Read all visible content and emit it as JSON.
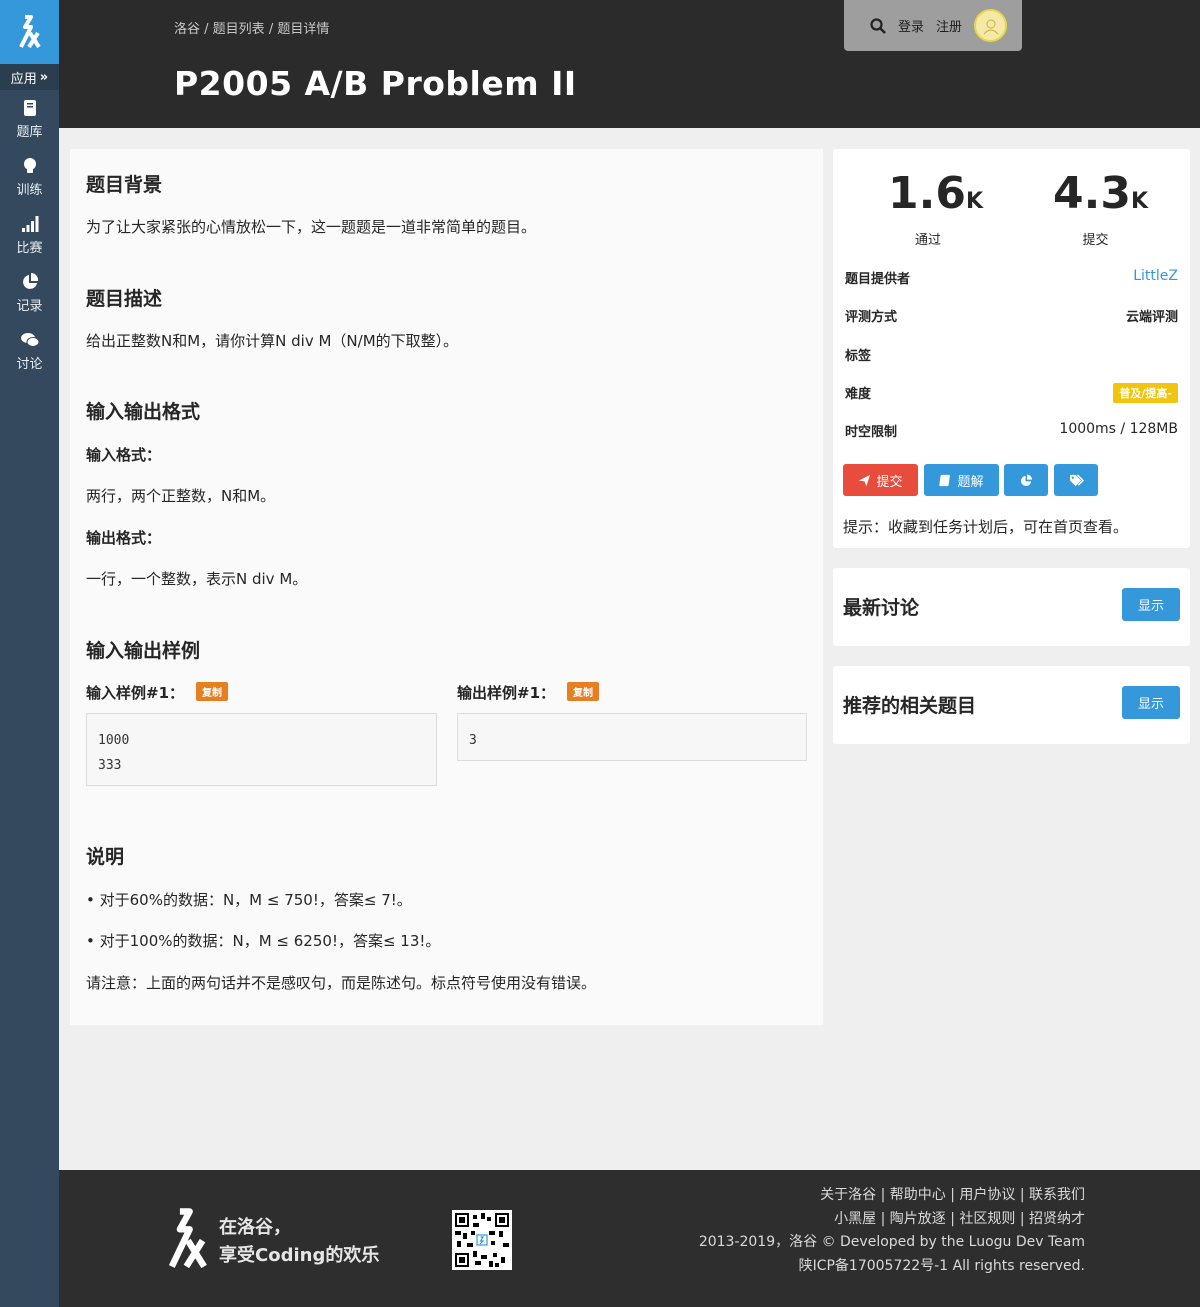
{
  "sidebar": {
    "app_label": "应用",
    "items": [
      {
        "label": "题库",
        "icon": "book-icon"
      },
      {
        "label": "训练",
        "icon": "lightbulb-icon"
      },
      {
        "label": "比赛",
        "icon": "signal-icon"
      },
      {
        "label": "记录",
        "icon": "pie-chart-icon"
      },
      {
        "label": "讨论",
        "icon": "comments-icon"
      }
    ]
  },
  "header": {
    "breadcrumb": [
      "洛谷",
      "题目列表",
      "题目详情"
    ],
    "separator": " / ",
    "title": "P2005 A/B Problem II",
    "login": "登录",
    "register": "注册"
  },
  "problem": {
    "background_title": "题目背景",
    "background_text": "为了让大家紧张的心情放松一下，这一题题是一道非常简单的题目。",
    "description_title": "题目描述",
    "description_text": "给出正整数N和M，请你计算N div M（N/M的下取整）。",
    "io_title": "输入输出格式",
    "input_format_label": "输入格式：",
    "input_format_text": "两行，两个正整数，N和M。",
    "output_format_label": "输出格式：",
    "output_format_text": "一行，一个整数，表示N div M。",
    "samples_title": "输入输出样例",
    "input_sample_label": "输入样例#1：",
    "output_sample_label": "输出样例#1：",
    "copy_label": "复制",
    "input_sample": "1000\n333",
    "output_sample": "3",
    "notes_title": "说明",
    "note_1": "• 对于60%的数据：N，M ≤ 750!，答案≤ 7!。",
    "note_2": "• 对于100%的数据：N，M ≤ 6250!，答案≤ 13!。",
    "note_3": "请注意：上面的两句话并不是感叹句，而是陈述句。标点符号使用没有错误。"
  },
  "stats": {
    "passed_value": "1.6",
    "passed_unit": "K",
    "passed_label": "通过",
    "submitted_value": "4.3",
    "submitted_unit": "K",
    "submitted_label": "提交"
  },
  "info": {
    "provider_label": "题目提供者",
    "provider_value": "LittleZ",
    "judge_label": "评测方式",
    "judge_value": "云端评测",
    "tags_label": "标签",
    "difficulty_label": "难度",
    "difficulty_value": "普及/提高-",
    "limit_label": "时空限制",
    "limit_value": "1000ms / 128MB"
  },
  "actions": {
    "submit_label": "提交",
    "solution_label": "题解",
    "hint": "提示：收藏到任务计划后，可在首页查看。"
  },
  "panels": {
    "discussion_title": "最新讨论",
    "related_title": "推荐的相关题目",
    "show_label": "显示"
  },
  "footer": {
    "slogan_line1": "在洛谷，",
    "slogan_line2": "享受Coding的欢乐",
    "links_row1": "关于洛谷 | 帮助中心 | 用户协议 | 联系我们",
    "links_row2": "小黑屋 | 陶片放逐 | 社区规则 | 招贤纳才",
    "copyright": "2013-2019，洛谷 © Developed by the Luogu Dev Team",
    "icp": "陕ICP备17005722号-1 All rights reserved."
  },
  "colors": {
    "brand_blue": "#3498db",
    "sidebar": "#34495e",
    "submit_red": "#e74c3c",
    "difficulty_yellow": "#f1c40f",
    "copy_orange": "#e67e22"
  }
}
